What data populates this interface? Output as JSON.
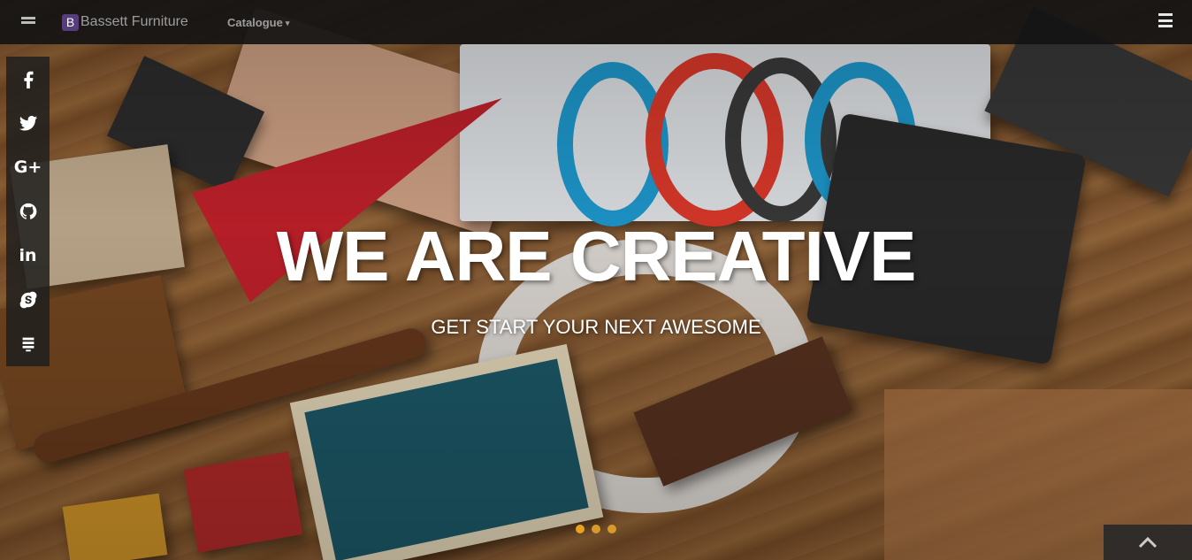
{
  "navbar": {
    "brand_logo": "B",
    "brand_name": "Bassett Furniture",
    "catalogue_label": "Catalogue",
    "caret": "▾"
  },
  "social": [
    {
      "name": "facebook",
      "icon": "facebook-icon"
    },
    {
      "name": "twitter",
      "icon": "twitter-icon"
    },
    {
      "name": "google-plus",
      "icon": "google-plus-icon",
      "label": "G+"
    },
    {
      "name": "github",
      "icon": "github-icon"
    },
    {
      "name": "linkedin",
      "icon": "linkedin-icon",
      "label": "in"
    },
    {
      "name": "skype",
      "icon": "skype-icon"
    },
    {
      "name": "stack-overflow",
      "icon": "stack-overflow-icon"
    }
  ],
  "hero": {
    "headline": "WE ARE CREATIVE",
    "subheadline": "GET START YOUR NEXT AWESOME"
  },
  "carousel": {
    "slides": 3,
    "active_index": 0,
    "dot_color": "#e8a21e"
  },
  "colors": {
    "navbar_bg": "#141414",
    "brand_logo_bg": "#563d7c",
    "nav_text": "#9d9d9d"
  },
  "back_to_top": {
    "icon": "chevron-up-icon"
  }
}
